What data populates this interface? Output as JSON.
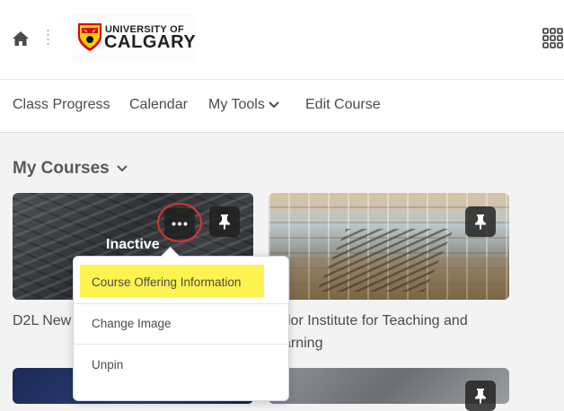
{
  "header": {
    "home_icon": "home-icon",
    "logo": {
      "line1": "UNIVERSITY OF",
      "line2": "CALGARY"
    },
    "apps_icon": "waffle-grid-icon"
  },
  "nav": {
    "items": [
      {
        "label": "Class Progress"
      },
      {
        "label": "Calendar"
      },
      {
        "label": "My Tools",
        "has_dropdown": true
      },
      {
        "label": "Edit Course"
      }
    ]
  },
  "my_courses": {
    "title": "My Courses",
    "cards": [
      {
        "status": "Inactive",
        "title": "D2L New"
      },
      {
        "title_line1": "ylor Institute for Teaching and",
        "title_line2": "arning"
      }
    ]
  },
  "context_menu": {
    "items": [
      {
        "label": "Course Offering Information",
        "highlighted": true
      },
      {
        "label": "Change Image"
      },
      {
        "label": "Unpin"
      }
    ]
  },
  "colors": {
    "highlight": "#fff34f",
    "annotation_ring": "#d9332e",
    "text": "#494c4e",
    "page_bg": "#f3f3f3"
  }
}
